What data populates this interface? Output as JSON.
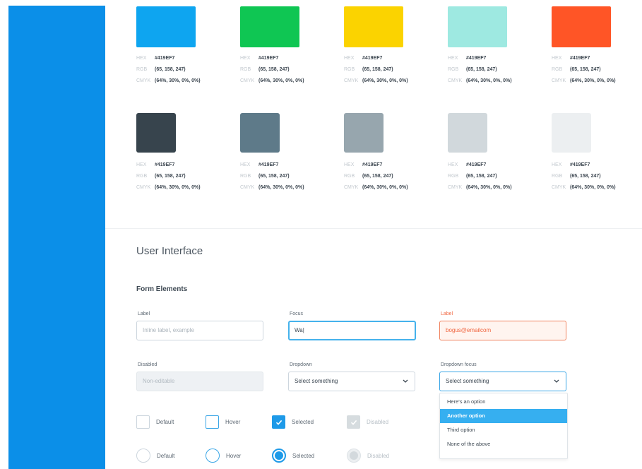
{
  "palette": {
    "labels": {
      "hex": "HEX",
      "rgb": "RGB",
      "cmyk": "CMYK"
    },
    "rows": [
      {
        "swatches": [
          {
            "color": "#0ea5f0",
            "hex": "#419EF7",
            "rgb": "(65, 158, 247)",
            "cmyk": "(64%, 30%, 0%, 0%)"
          },
          {
            "color": "#0fc653",
            "hex": "#419EF7",
            "rgb": "(65, 158, 247)",
            "cmyk": "(64%, 30%, 0%, 0%)"
          },
          {
            "color": "#fbd300",
            "hex": "#419EF7",
            "rgb": "(65, 158, 247)",
            "cmyk": "(64%, 30%, 0%, 0%)"
          },
          {
            "color": "#9ee9e1",
            "hex": "#419EF7",
            "rgb": "(65, 158, 247)",
            "cmyk": "(64%, 30%, 0%, 0%)"
          },
          {
            "color": "#ff5526",
            "hex": "#419EF7",
            "rgb": "(65, 158, 247)",
            "cmyk": "(64%, 30%, 0%, 0%)"
          }
        ]
      },
      {
        "swatches": [
          {
            "color": "#37444d",
            "hex": "#419EF7",
            "rgb": "(65, 158, 247)",
            "cmyk": "(64%, 30%, 0%, 0%)"
          },
          {
            "color": "#5e7a89",
            "hex": "#419EF7",
            "rgb": "(65, 158, 247)",
            "cmyk": "(64%, 30%, 0%, 0%)"
          },
          {
            "color": "#97a6ae",
            "hex": "#419EF7",
            "rgb": "(65, 158, 247)",
            "cmyk": "(64%, 30%, 0%, 0%)"
          },
          {
            "color": "#d1d8dc",
            "hex": "#419EF7",
            "rgb": "(65, 158, 247)",
            "cmyk": "(64%, 30%, 0%, 0%)"
          },
          {
            "color": "#eceff1",
            "hex": "#419EF7",
            "rgb": "(65, 158, 247)",
            "cmyk": "(64%, 30%, 0%, 0%)"
          }
        ]
      }
    ]
  },
  "ui": {
    "section_title": "User Interface",
    "form_title": "Form Elements",
    "fields": {
      "label": {
        "label": "Label",
        "placeholder": "Inline label, example"
      },
      "focus": {
        "label": "Focus",
        "value": "Wa"
      },
      "error": {
        "label": "Label",
        "value": "bogus@emailcom"
      },
      "disabled": {
        "label": "Disabled",
        "value": "Non-editable"
      },
      "dropdown": {
        "label": "Dropdown",
        "value": "Select something"
      },
      "dropdown_focus": {
        "label": "Dropdown focus",
        "value": "Select something"
      }
    },
    "dropdown_options": [
      "Here's an option",
      "Another option",
      "Third option",
      "None of the above"
    ],
    "checkboxes": [
      "Default",
      "Hover",
      "Selected",
      "Disabled"
    ],
    "radios": [
      "Default",
      "Hover",
      "Selected",
      "Disabled"
    ]
  },
  "colors": {
    "sidebar": "#0b8fe8",
    "accent": "#1e9ae8",
    "focus_border": "#45b2ec",
    "error": "#f26b46"
  },
  "icons": {
    "dropdown": "chevron-down-icon",
    "checkbox_selected": "check-icon"
  }
}
